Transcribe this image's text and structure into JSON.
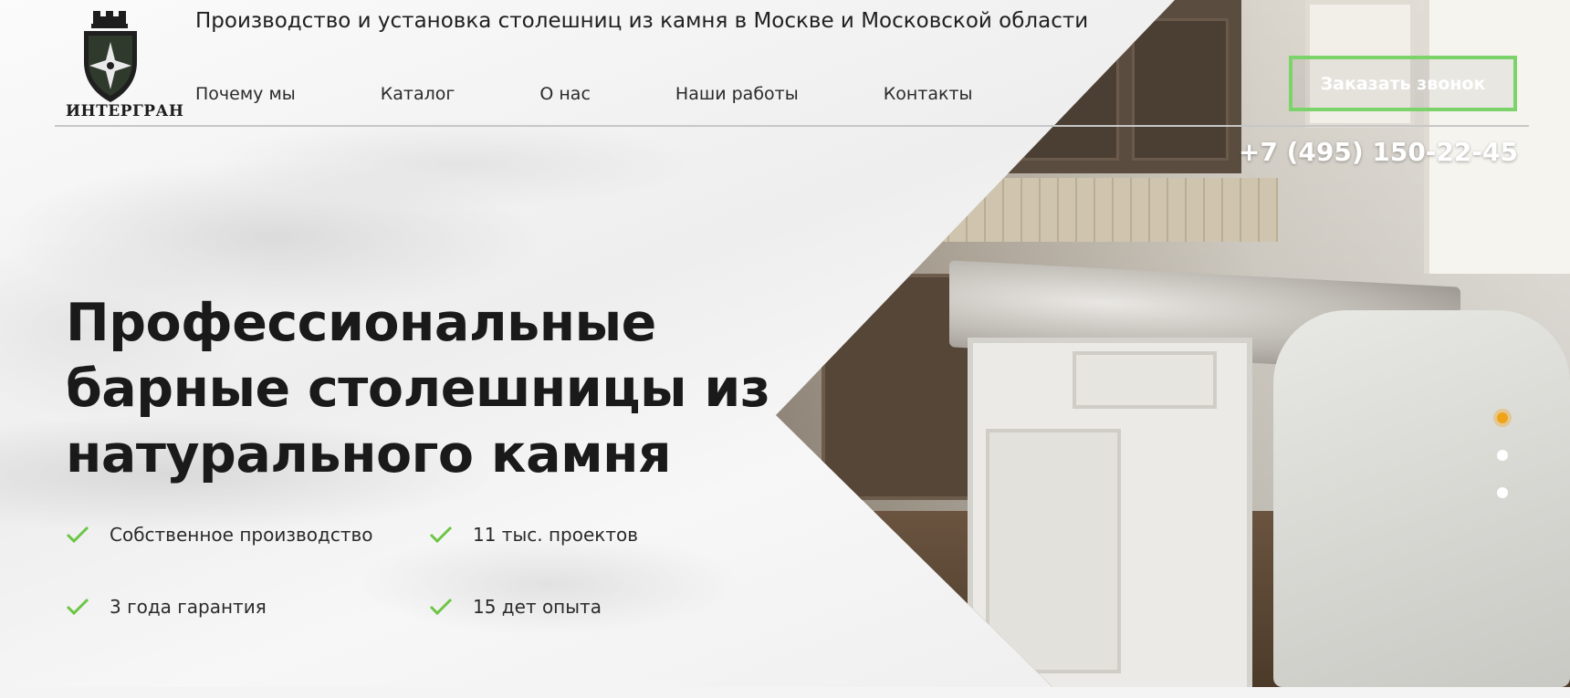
{
  "brand": {
    "logo_text": "ИНТЕРГРАН",
    "tagline": "Производство и установка столешниц из камня в Москве и Московской области"
  },
  "nav": {
    "items": [
      "Почему мы",
      "Каталог",
      "О нас",
      "Наши работы",
      "Контакты"
    ]
  },
  "header": {
    "call_button_label": "Заказать звонок",
    "phone": "+7 (495) 150-22-45"
  },
  "hero": {
    "title": "Профессиональные\nбарные столешницы из\nнатурального камня",
    "features": [
      "Собственное производство",
      "11 тыс. проектов",
      "3 года гарантия",
      "15 дет опыта"
    ]
  },
  "slider": {
    "active_index": 0,
    "count": 3
  },
  "colors": {
    "accent_green": "#7bd36a",
    "check_green": "#6cc644",
    "active_dot": "#f0a316",
    "text_dark": "#1a1a1a"
  },
  "icons": {
    "logo": "shield-crest-icon",
    "feature": "check-icon"
  }
}
